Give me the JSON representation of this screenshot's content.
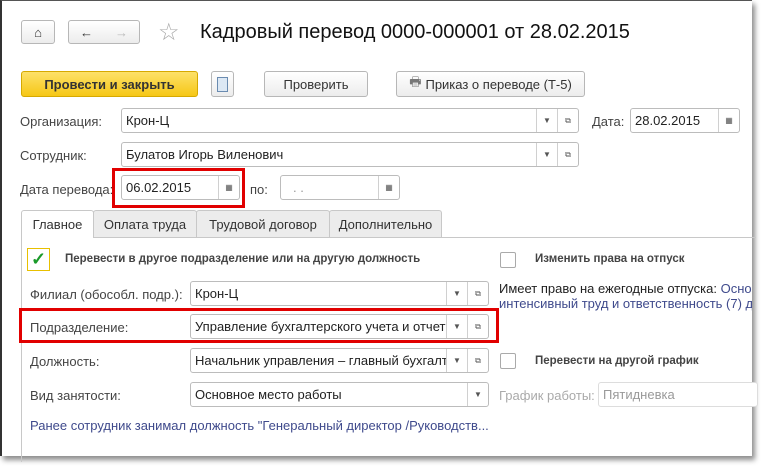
{
  "header": {
    "title": "Кадровый перевод 0000-000001 от 28.02.2015"
  },
  "toolbar": {
    "post_close": "Провести и закрыть",
    "check": "Проверить",
    "print": "Приказ о переводе (Т-5)"
  },
  "form": {
    "org_label": "Организация:",
    "org_value": "Крон-Ц",
    "date_label": "Дата:",
    "date_value": "28.02.2015",
    "employee_label": "Сотрудник:",
    "employee_value": "Булатов Игорь Виленович",
    "transfer_date_label": "Дата перевода:",
    "transfer_date_value": "06.02.2015",
    "to_label": "по:",
    "to_value": " .  ."
  },
  "tabs": [
    {
      "label": "Главное"
    },
    {
      "label": "Оплата труда"
    },
    {
      "label": "Трудовой договор"
    },
    {
      "label": "Дополнительно"
    }
  ],
  "main": {
    "transfer_checkbox": "Перевести в другое подразделение или на другую должность",
    "branch_label": "Филиал (обособл. подр.):",
    "branch_value": "Крон-Ц",
    "dept_label": "Подразделение:",
    "dept_value": "Управление бухгалтерского учета и отчет",
    "position_label": "Должность:",
    "position_value": "Начальник управления – главный бухгалт",
    "employment_label": "Вид занятости:",
    "employment_value": "Основное место работы",
    "previous_note": "Ранее сотрудник занимал должность \"Генеральный директор /Руководств...",
    "vacation_checkbox": "Изменить права на отпуск",
    "vacation_text": "Имеет право на ежегодные отпуска:",
    "vacation_link1": "Осно",
    "vacation_link2": "интенсивный труд и ответственность (7) д",
    "schedule_checkbox": "Перевести на другой график",
    "schedule_label": "График работы:",
    "schedule_value": "Пятидневка"
  }
}
